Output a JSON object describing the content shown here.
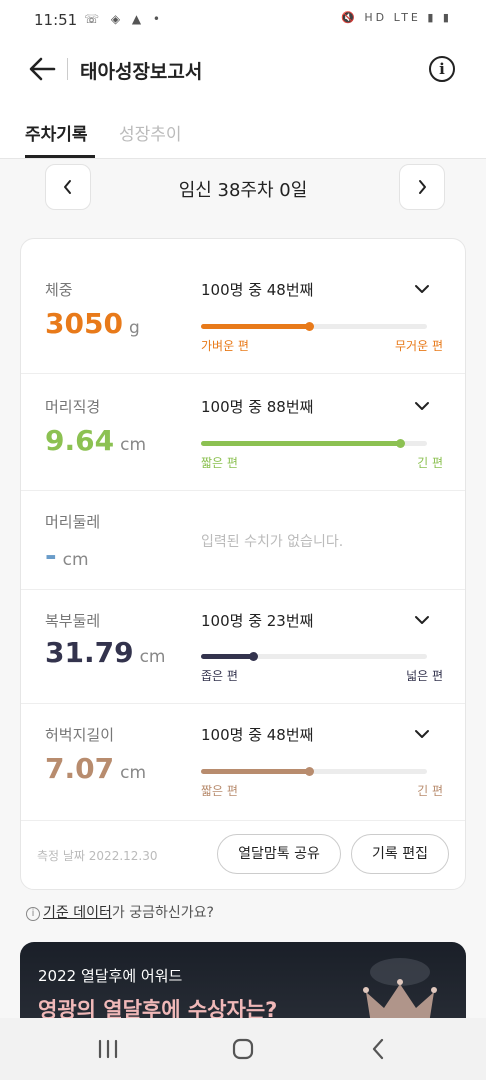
{
  "status_bar": {
    "time": "11:51",
    "left_icons": "☏ ◈ ▲ •",
    "right_icons": "🔇 HD LTE ▮ ▮"
  },
  "header": {
    "title": "태아성장보고서",
    "info_label": "i"
  },
  "tabs": [
    {
      "label": "주차기록",
      "active": true
    },
    {
      "label": "성장추이",
      "active": false
    }
  ],
  "week_nav": {
    "title": "임신 38주차 0일"
  },
  "measurements": [
    {
      "label": "체중",
      "value": "3050",
      "unit": "g",
      "rank": "100명 중 48번째",
      "position": 0.48,
      "low_label": "가벼운 편",
      "high_label": "무거운 편",
      "color": "#e87a1a",
      "empty": false
    },
    {
      "label": "머리직경",
      "value": "9.64",
      "unit": "cm",
      "rank": "100명 중 88번째",
      "position": 0.88,
      "low_label": "짧은 편",
      "high_label": "긴 편",
      "color": "#8cc152",
      "empty": false
    },
    {
      "label": "머리둘레",
      "value": "-",
      "unit": "cm",
      "empty_message": "입력된 수치가 없습니다.",
      "color": "#6a9cc9",
      "empty": true
    },
    {
      "label": "복부둘레",
      "value": "31.79",
      "unit": "cm",
      "rank": "100명 중 23번째",
      "position": 0.23,
      "low_label": "좁은 편",
      "high_label": "넓은 편",
      "color": "#33334d",
      "empty": false
    },
    {
      "label": "허벅지길이",
      "value": "7.07",
      "unit": "cm",
      "rank": "100명 중 48번째",
      "position": 0.48,
      "low_label": "짧은 편",
      "high_label": "긴 편",
      "color": "#b88c6e",
      "empty": false
    }
  ],
  "card_footer": {
    "measure_date": "측정 날짜 2022.12.30",
    "share_label": "열달맘톡 공유",
    "edit_label": "기록 편집"
  },
  "help": {
    "link": "기준 데이터",
    "rest": "가 궁금하신가요?"
  },
  "banner": {
    "line1": "2022 열달후에 어워드",
    "line2": "영광의 열달후에 수상자는?"
  }
}
